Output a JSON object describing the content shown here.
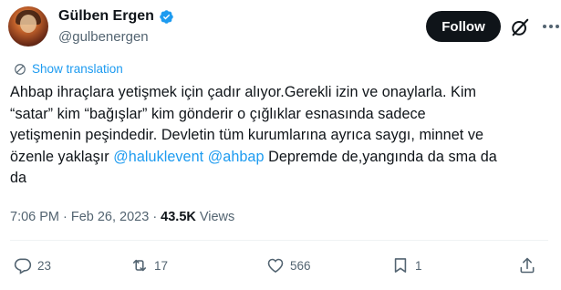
{
  "author": {
    "display_name": "Gülben Ergen",
    "handle": "@gulbenergen"
  },
  "follow_label": "Follow",
  "translation_label": "Show translation",
  "tweet": {
    "line1": "Ahbap ihraçlara yetişmek için çadır alıyor.Gerekli izin ve onaylarla. Kim",
    "line2": "“satar” kim “bağışlar” kim gönderir o çığlıklar esnasında sadece",
    "line3": "yetişmenin peşindedir. Devletin tüm kurumlarına ayrıca saygı, minnet ve",
    "line4_before": "özenle yaklaşır ",
    "mention1": "@haluklevent",
    "line4_space": " ",
    "mention2": "@ahbap",
    "line4_after": " Depremde de,yangında da sma da",
    "line5": "da"
  },
  "meta": {
    "time": "7:06 PM",
    "sep1": "·",
    "date": "Feb 26, 2023",
    "sep2": "·",
    "views_count": "43.5K",
    "views_label": "Views"
  },
  "actions": {
    "replies": "23",
    "reposts": "17",
    "likes": "566",
    "bookmarks": "1"
  },
  "colors": {
    "accent": "#1d9bf0",
    "text": "#0f1419",
    "muted": "#536471",
    "follow_bg": "#0f1419"
  },
  "icons": [
    "verified-badge-icon",
    "grok-icon",
    "more-icon",
    "translate-icon",
    "reply-icon",
    "repost-icon",
    "like-icon",
    "bookmark-icon",
    "share-icon"
  ]
}
